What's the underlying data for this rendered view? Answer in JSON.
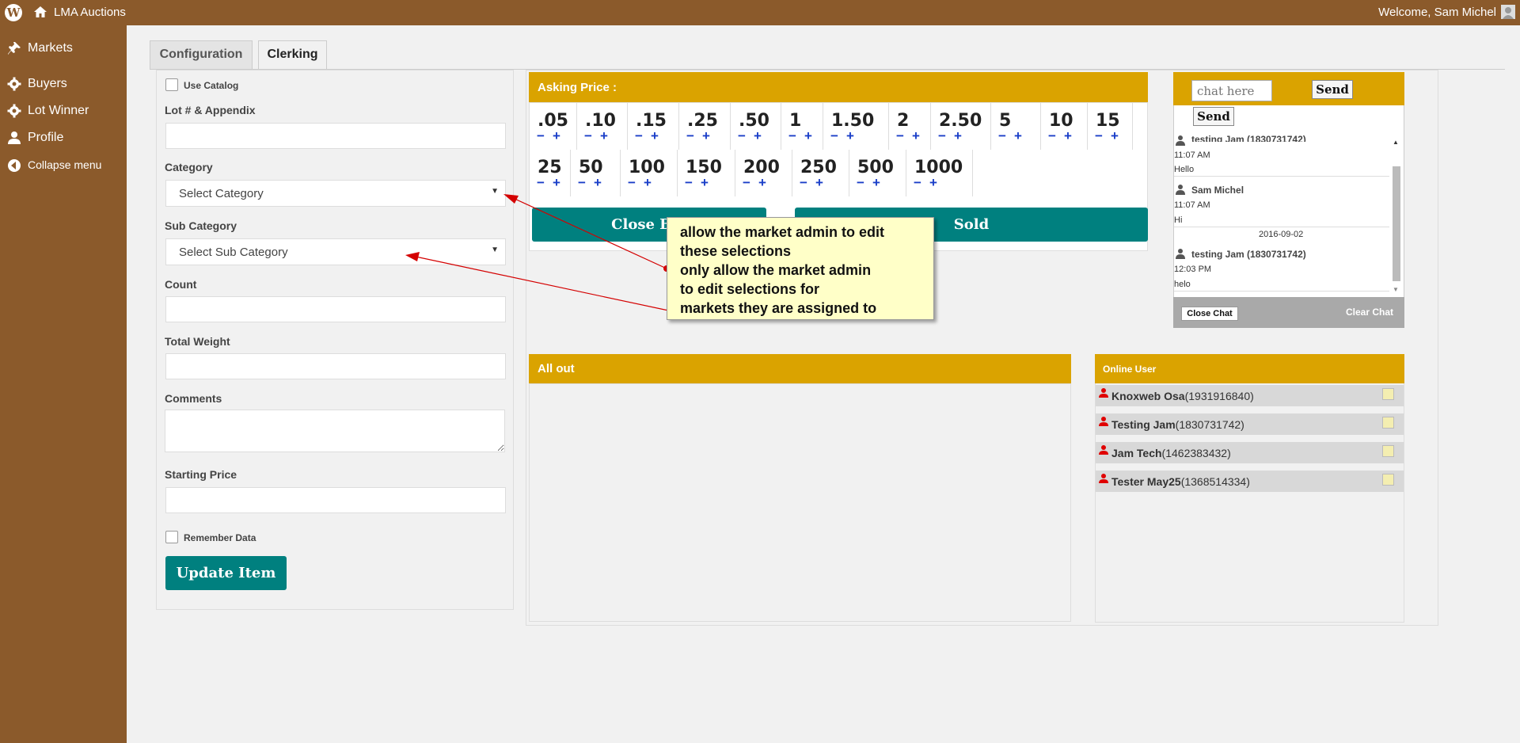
{
  "adminbar": {
    "site_name": "LMA Auctions",
    "welcome": "Welcome, Sam Michel"
  },
  "sidemenu": {
    "items": [
      {
        "label": "Markets",
        "icon": "pin-icon"
      },
      {
        "label": "Buyers",
        "icon": "gear-icon"
      },
      {
        "label": "Lot Winner",
        "icon": "gear-icon"
      },
      {
        "label": "Profile",
        "icon": "user-icon"
      },
      {
        "label": "Collapse menu",
        "icon": "collapse-icon"
      }
    ]
  },
  "tabs": [
    {
      "label": "Configuration",
      "active": false
    },
    {
      "label": "Clerking",
      "active": true
    }
  ],
  "form": {
    "use_catalog": "Use Catalog",
    "lot_label": "Lot # & Appendix",
    "lot_value": "",
    "category_label": "Category",
    "category_value": "Select Category",
    "subcategory_label": "Sub Category",
    "subcategory_value": "Select Sub Category",
    "count_label": "Count",
    "count_value": "",
    "weight_label": "Total Weight",
    "weight_value": "",
    "comments_label": "Comments",
    "comments_value": "",
    "starting_price_label": "Starting Price",
    "starting_price_value": "",
    "remember_data": "Remember Data",
    "update_button": "Update Item"
  },
  "asking": {
    "header": "Asking Price :",
    "minus": "−",
    "plus": "+",
    "prices_row1": [
      ".05",
      ".10",
      ".15",
      ".25",
      ".50",
      "1",
      "1.50",
      "2",
      "2.50",
      "5",
      "10",
      "15"
    ],
    "prices_row2": [
      "25",
      "50",
      "100",
      "150",
      "200",
      "250",
      "500",
      "1000"
    ],
    "close_bid": "Close Bid",
    "sold": "Sold"
  },
  "allout": {
    "header": "All out"
  },
  "chat": {
    "placeholder": "chat here",
    "send1": "Send",
    "send2": "Send",
    "messages": [
      {
        "name": "testing Jam (1830731742)",
        "time": "11:07 AM",
        "text": "Hello"
      },
      {
        "name": "Sam Michel",
        "time": "11:07 AM",
        "text": "Hi"
      },
      {
        "name": "testing Jam (1830731742)",
        "time": "12:03 PM",
        "text": "helo"
      }
    ],
    "date_divider": "2016-09-02",
    "close_chat": "Close Chat",
    "clear_chat": "Clear Chat"
  },
  "online": {
    "header": "Online User",
    "users": [
      {
        "name": "Knoxweb Osa",
        "id": "(1931916840)"
      },
      {
        "name": "Testing Jam",
        "id": "(1830731742)"
      },
      {
        "name": "Jam Tech",
        "id": "(1462383432)"
      },
      {
        "name": "Tester May25",
        "id": "(1368514334)"
      }
    ]
  },
  "annotation": {
    "lines": [
      "allow the market admin to edit",
      "these selections",
      "only allow the market admin",
      "to edit selections for",
      "markets they are assigned to"
    ]
  },
  "colors": {
    "brand": "#8b5a2b",
    "accent": "#daa300",
    "teal": "#00807f",
    "plus_minus": "#1a3ec8",
    "annotation_bg": "#ffffc8",
    "arrow": "#d40000"
  }
}
